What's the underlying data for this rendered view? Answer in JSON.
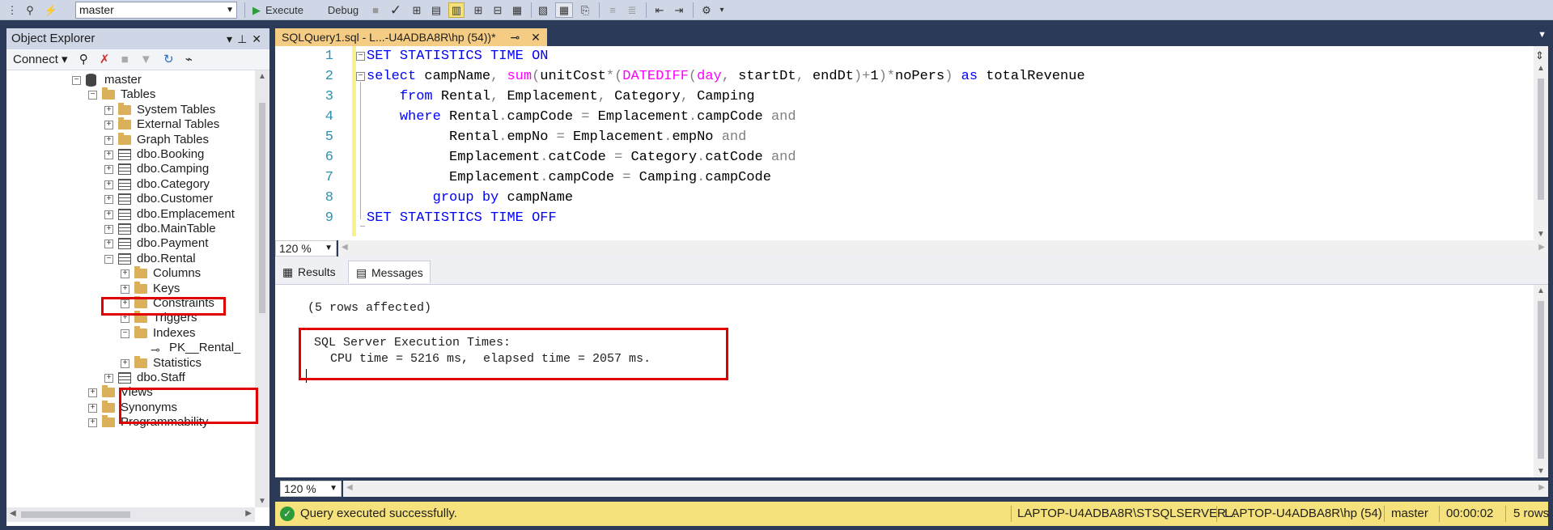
{
  "toolbar": {
    "database": "master",
    "execute_label": "Execute",
    "debug_label": "Debug"
  },
  "object_explorer": {
    "title": "Object Explorer",
    "connect_label": "Connect",
    "tree": [
      {
        "label": "master",
        "icon": "database-icon",
        "exp": "-"
      },
      {
        "label": "Tables",
        "icon": "folder-icon",
        "exp": "-"
      },
      {
        "label": "System Tables",
        "icon": "folder-icon",
        "exp": "+"
      },
      {
        "label": "External Tables",
        "icon": "folder-icon",
        "exp": "+"
      },
      {
        "label": "Graph Tables",
        "icon": "folder-icon",
        "exp": "+"
      },
      {
        "label": "dbo.Booking",
        "icon": "table-icon",
        "exp": "+"
      },
      {
        "label": "dbo.Camping",
        "icon": "table-icon",
        "exp": "+"
      },
      {
        "label": "dbo.Category",
        "icon": "table-icon",
        "exp": "+"
      },
      {
        "label": "dbo.Customer",
        "icon": "table-icon",
        "exp": "+"
      },
      {
        "label": "dbo.Emplacement",
        "icon": "table-icon",
        "exp": "+"
      },
      {
        "label": "dbo.MainTable",
        "icon": "table-icon",
        "exp": "+"
      },
      {
        "label": "dbo.Payment",
        "icon": "table-icon",
        "exp": "+"
      },
      {
        "label": "dbo.Rental",
        "icon": "table-icon",
        "exp": "-"
      },
      {
        "label": "Columns",
        "icon": "folder-icon",
        "exp": "+"
      },
      {
        "label": "Keys",
        "icon": "folder-icon",
        "exp": "+"
      },
      {
        "label": "Constraints",
        "icon": "folder-icon",
        "exp": "+"
      },
      {
        "label": "Triggers",
        "icon": "folder-icon",
        "exp": "+"
      },
      {
        "label": "Indexes",
        "icon": "folder-icon",
        "exp": "-"
      },
      {
        "label": "PK__Rental_",
        "icon": "key-icon",
        "exp": ""
      },
      {
        "label": "Statistics",
        "icon": "folder-icon",
        "exp": "+"
      },
      {
        "label": "dbo.Staff",
        "icon": "table-icon",
        "exp": "+"
      },
      {
        "label": "Views",
        "icon": "folder-icon",
        "exp": "+"
      },
      {
        "label": "Synonyms",
        "icon": "folder-icon",
        "exp": "+"
      },
      {
        "label": "Programmability",
        "icon": "folder-icon",
        "exp": "+"
      }
    ]
  },
  "query_tab": {
    "label": "SQLQuery1.sql - L...-U4ADBA8R\\hp (54))*"
  },
  "editor": {
    "line_numbers": [
      "1",
      "2",
      "3",
      "4",
      "5",
      "6",
      "7",
      "8",
      "9"
    ],
    "zoom": "120 %"
  },
  "results": {
    "tab_results": "Results",
    "tab_messages": "Messages",
    "rows_affected": "(5 rows affected)",
    "exec_times_header": "SQL Server Execution Times:",
    "exec_times_detail": "CPU time = 5216 ms,  elapsed time = 2057 ms.",
    "zoom": "120 %"
  },
  "status": {
    "message": "Query executed successfully.",
    "server": "LAPTOP-U4ADBA8R\\STSQLSERVER...",
    "user": "LAPTOP-U4ADBA8R\\hp (54)",
    "database": "master",
    "elapsed": "00:00:02",
    "rows": "5 rows"
  },
  "colors": {
    "chrome": "#2b3a58",
    "toolbar": "#cfd6e5",
    "status_bar": "#f5e27d",
    "tab_active": "#f5cc84",
    "highlight_box": "#e00000",
    "keyword": "#0000ff",
    "function": "#ff00ff",
    "operator": "#808080"
  }
}
